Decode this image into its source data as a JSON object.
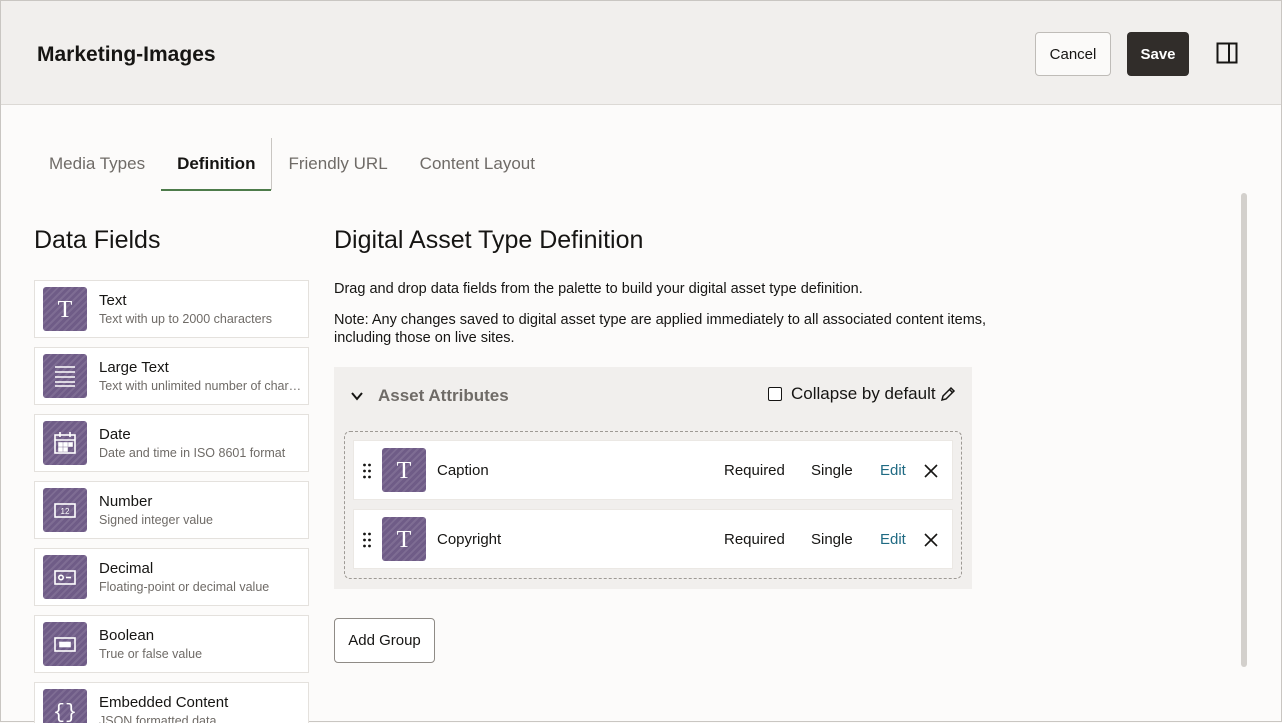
{
  "header": {
    "title": "Marketing-Images",
    "cancel_label": "Cancel",
    "save_label": "Save",
    "panel_icon": "panel-toggle-icon"
  },
  "tabs": [
    {
      "label": "Media Types",
      "active": false
    },
    {
      "label": "Definition",
      "active": true
    },
    {
      "label": "Friendly URL",
      "active": false
    },
    {
      "label": "Content Layout",
      "active": false
    }
  ],
  "palette": {
    "title": "Data Fields",
    "items": [
      {
        "name": "Text",
        "desc": "Text with up to 2000 characters",
        "icon": "text-icon"
      },
      {
        "name": "Large Text",
        "desc": "Text with unlimited number of characters",
        "icon": "large-text-icon"
      },
      {
        "name": "Date",
        "desc": "Date and time in ISO 8601 format",
        "icon": "calendar-icon"
      },
      {
        "name": "Number",
        "desc": "Signed integer value",
        "icon": "number-icon"
      },
      {
        "name": "Decimal",
        "desc": "Floating-point or decimal value",
        "icon": "decimal-icon"
      },
      {
        "name": "Boolean",
        "desc": "True or false value",
        "icon": "boolean-icon"
      },
      {
        "name": "Embedded Content",
        "desc": "JSON formatted data",
        "icon": "braces-icon"
      }
    ]
  },
  "definition": {
    "title": "Digital Asset Type Definition",
    "intro": "Drag and drop data fields from the palette to build your digital asset type definition.",
    "note": "Note: Any changes saved to digital asset type are applied immediately to all associated content items, including those on live sites.",
    "group": {
      "title": "Asset Attributes",
      "collapse_label": "Collapse by default",
      "collapse_checked": false,
      "fields": [
        {
          "name": "Caption",
          "required": "Required",
          "cardinality": "Single",
          "edit": "Edit"
        },
        {
          "name": "Copyright",
          "required": "Required",
          "cardinality": "Single",
          "edit": "Edit"
        }
      ]
    },
    "add_group_label": "Add Group"
  },
  "colors": {
    "accent_tab": "#4d7b4a",
    "save_bg": "#312d2a",
    "icon_bg": "#6f5c87",
    "link": "#1f6a83"
  }
}
